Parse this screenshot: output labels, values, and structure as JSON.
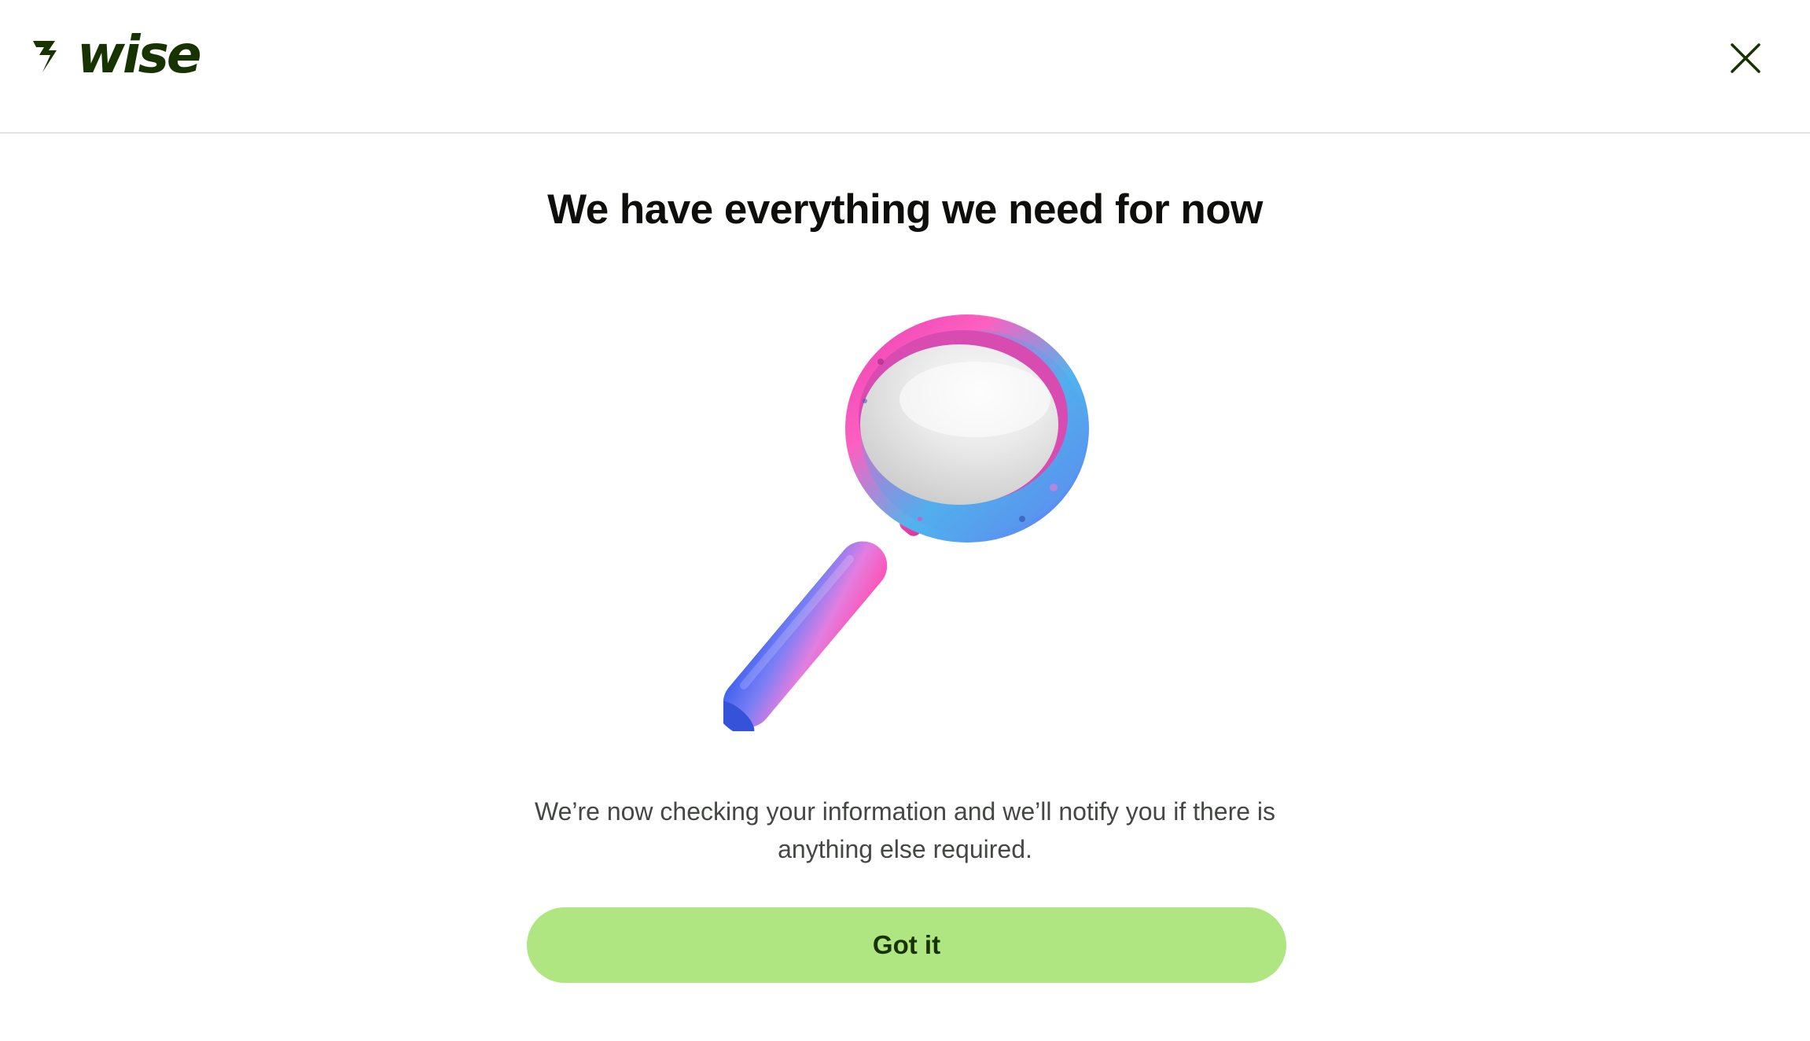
{
  "header": {
    "logo_text": "wise",
    "logo_icon": "wise-flag-icon",
    "close_icon": "close-icon"
  },
  "main": {
    "title": "We have everything we need for now",
    "illustration_icon": "magnifying-glass-icon",
    "message": "We’re now checking your information and we’ll notify you if there is anything else required.",
    "button_label": "Got it"
  },
  "colors": {
    "brand_dark": "#163300",
    "button_bg": "#b0e681",
    "text_secondary": "#454745"
  }
}
